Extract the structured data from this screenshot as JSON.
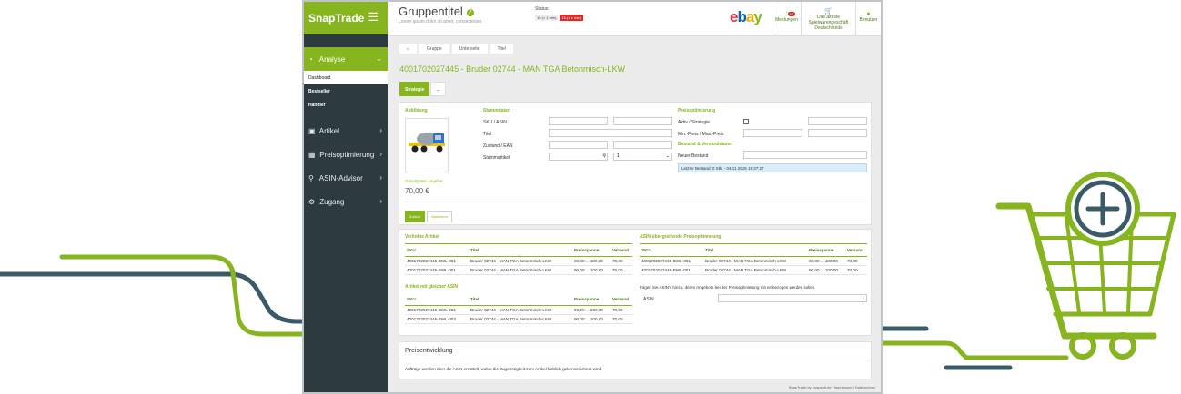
{
  "brand": {
    "name": "SnapTrade"
  },
  "sidebar": {
    "items": [
      {
        "label": "Analyse",
        "icon": "gauge-icon"
      },
      {
        "label": "Artikel",
        "icon": "briefcase-icon"
      },
      {
        "label": "Preisoptimierung",
        "icon": "cubes-icon"
      },
      {
        "label": "ASIN-Advisor",
        "icon": "search-plus-icon"
      },
      {
        "label": "Zugang",
        "icon": "cogs-icon"
      }
    ],
    "sub_items": [
      "Dashboard",
      "Bestseller",
      "Händler"
    ]
  },
  "header": {
    "title": "Gruppentitel",
    "subtitle": "Lorem ipsum dolor sit amet, consectetuer",
    "status_label": "Status:",
    "badges": [
      "15 (> 1 min)",
      "15 (< 1 min)"
    ],
    "logo_letters": [
      "e",
      "b",
      "a",
      "y"
    ],
    "notifications": {
      "label": "Meldungen",
      "count": "40"
    },
    "shop": {
      "line1": "Das älteste",
      "line2": "Spielwarengeschäft",
      "line3": "Deutschlands"
    },
    "user": {
      "label": "Benutzer"
    }
  },
  "breadcrumb": [
    "Gruppe",
    "Unterseite",
    "Titel"
  ],
  "page_title": "4001702027445 - Bruder 02744 - MAN TGA Betonmisch-LKW",
  "tabs": [
    "Strategie",
    "..."
  ],
  "detail": {
    "image_heading": "Abbildung",
    "cheapest_label": "Günstigstes Angebot",
    "cheapest_price": "70,00 €",
    "master_heading": "Stammdaten",
    "fields": [
      "SKU / ASIN",
      "Titel",
      "Zustand / EAN",
      "Stammartikel"
    ],
    "select_value": "1",
    "price_heading": "Preisoptimierung",
    "price_fields": [
      "Aktiv / Strategie",
      "Min.-Preis / Max.-Preis"
    ],
    "stock_heading": "Bestand & Versanddauer",
    "stock_field": "Neuer Bestand",
    "last_stock": "Letzter Bestand: 0 Stk. - 04.11.2015 19:27:27",
    "buttons": [
      "Zurück",
      "Speichern"
    ]
  },
  "linked": {
    "heading": "Verlinkte Artikel",
    "columns": [
      "SKU",
      "Titel",
      "Preisspanne",
      "Versand"
    ],
    "rows": [
      [
        "4001702027445-BWL-001",
        "Bruder 02744 - MAN TGA Betonmisch-LKW",
        "90,00 ... 100,00",
        "70,00"
      ],
      [
        "4001702027445-BWL-001",
        "Bruder 02744 - MAN TGA Betonmisch-LKW",
        "90,00 ... 100,00",
        "70,00"
      ]
    ]
  },
  "same_asin": {
    "heading": "Artikel mit gleicher ASIN",
    "columns": [
      "SKU",
      "Titel",
      "Preisspanne",
      "Versand"
    ],
    "rows": [
      [
        "4001702027445-BWL-001",
        "Bruder 02744 - MAN TGA Betonmisch-LKW",
        "90,00 ... 100,00",
        "70,00"
      ],
      [
        "4001702027445-BWL-003",
        "Bruder 02744 - MAN TGA Betonmisch-LKW",
        "90,00 ... 100,00",
        "70,00"
      ]
    ]
  },
  "asin_cross": {
    "heading": "ASIN-übergreifende Preisoptimierung",
    "columns": [
      "SKU",
      "Titel",
      "Preisspanne",
      "Versand"
    ],
    "rows": [
      [
        "4001702027445-BWL-001",
        "Bruder 02744 - MAN TGA Betonmisch-LKW",
        "90,00 ... 100,00",
        "70,00"
      ],
      [
        "4001702027445-BWL-001",
        "Bruder 02744 - MAN TGA Betonmisch-LKW",
        "90,00 ... 100,00",
        "70,00"
      ]
    ],
    "note": "Fügen Sie ASIN's hinzu, deren Angebote bei der Preisoptimierung mit einbezogen werden sollen.",
    "asin_label": "ASIN"
  },
  "price_dev": {
    "heading": "Preisentwicklung",
    "text": "Aufträge werden über die ASIN ermittelt, wobei die Zugehörigkeit zum Artikel farblich gekennzeichnet wird."
  },
  "footer": "SnapTrade by snapsoft.de | Impressum | Datenschutz",
  "colors": {
    "accent": "#86b51f",
    "sidebar": "#2d3b40",
    "deco_blue": "#3a5a66"
  }
}
